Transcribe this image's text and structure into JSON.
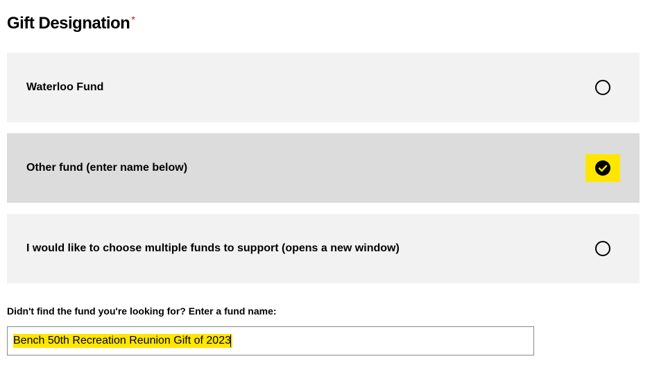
{
  "heading": "Gift Designation",
  "options": [
    {
      "label": "Waterloo Fund",
      "selected": false
    },
    {
      "label": "Other fund (enter name below)",
      "selected": true
    },
    {
      "label": "I would like to choose multiple funds to support (opens a new window)",
      "selected": false
    }
  ],
  "hint": "Didn't find the fund you're looking for? Enter a fund name:",
  "fund_input_value": "Bench 50th Recreation Reunion Gift of 2023"
}
